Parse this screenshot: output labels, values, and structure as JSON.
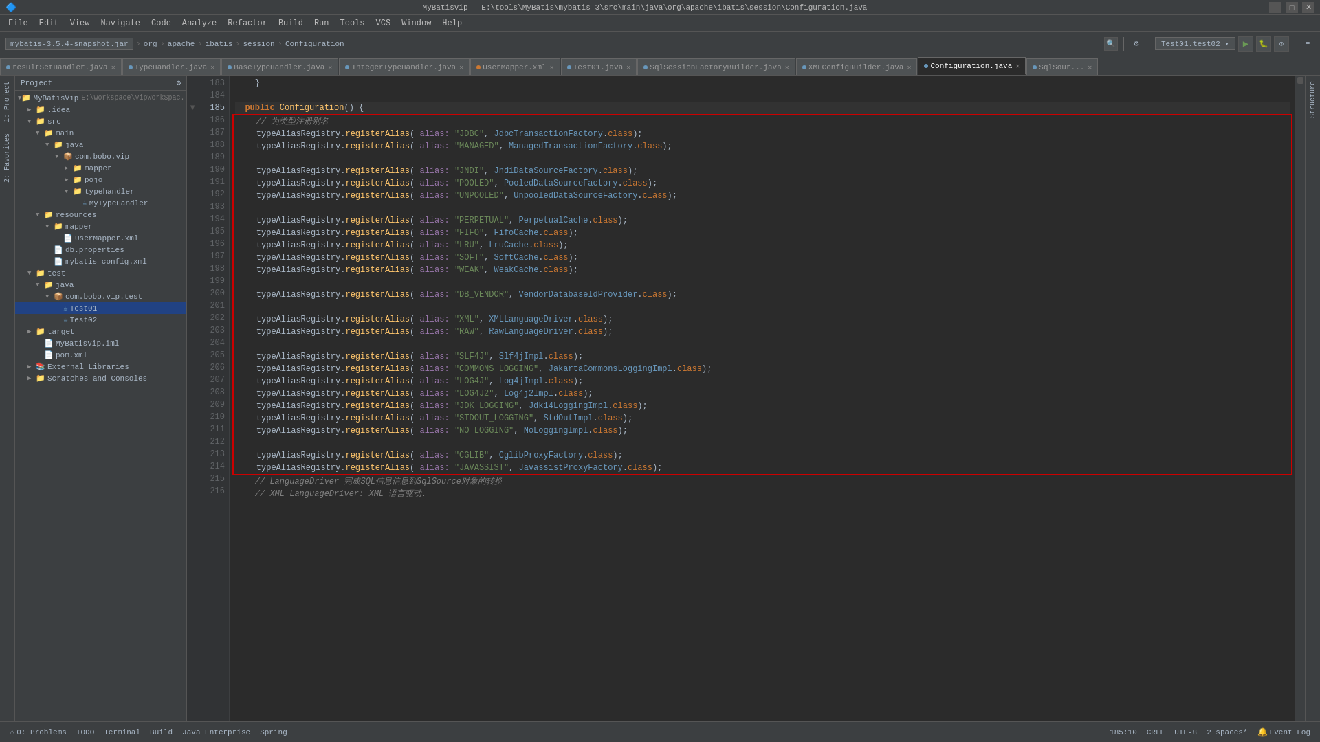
{
  "titlebar": {
    "title": "MyBatisVip – E:\\tools\\MyBatis\\mybatis-3\\src\\main\\java\\org\\apache\\ibatis\\session\\Configuration.java",
    "min": "−",
    "max": "□",
    "close": "✕"
  },
  "menubar": {
    "items": [
      "File",
      "Edit",
      "View",
      "Navigate",
      "Code",
      "Analyze",
      "Refactor",
      "Build",
      "Run",
      "Tools",
      "VCS",
      "Window",
      "Help"
    ]
  },
  "toolbar": {
    "project": "mybatis-3.5.4-snapshot.jar",
    "breadcrumb1": "org",
    "breadcrumb2": "apache",
    "breadcrumb3": "ibatis",
    "breadcrumb4": "session",
    "breadcrumb5": "Configuration",
    "run_config": "Test01.test02",
    "run_label": "▶",
    "debug_label": "🐛",
    "coverage_label": "⊙"
  },
  "filetabs": {
    "tabs": [
      {
        "label": "resultSetHandler.java",
        "active": false
      },
      {
        "label": "TypeHandler.java",
        "active": false
      },
      {
        "label": "BaseTypeHandler.java",
        "active": false
      },
      {
        "label": "IntegerTypeHandler.java",
        "active": false
      },
      {
        "label": "UserMapper.xml",
        "active": false
      },
      {
        "label": "Test01.java",
        "active": false
      },
      {
        "label": "SqlSessionFactoryBuilder.java",
        "active": false
      },
      {
        "label": "XMLConfigBuilder.java",
        "active": false
      },
      {
        "label": "Configuration.java",
        "active": true
      },
      {
        "label": "SqlSour...",
        "active": false
      }
    ]
  },
  "sidebar": {
    "header": "Project",
    "items": [
      {
        "indent": 0,
        "label": "MyBatisVip",
        "type": "project",
        "path": "E:\\workspace\\VipWorkSpac..."
      },
      {
        "indent": 1,
        "label": ".idea",
        "type": "folder"
      },
      {
        "indent": 1,
        "label": "src",
        "type": "folder",
        "open": true
      },
      {
        "indent": 2,
        "label": "main",
        "type": "folder",
        "open": true
      },
      {
        "indent": 3,
        "label": "java",
        "type": "folder",
        "open": true
      },
      {
        "indent": 4,
        "label": "com.bobo.vip",
        "type": "package",
        "open": true
      },
      {
        "indent": 5,
        "label": "mapper",
        "type": "folder"
      },
      {
        "indent": 5,
        "label": "pojo",
        "type": "folder"
      },
      {
        "indent": 5,
        "label": "typehandler",
        "type": "folder",
        "open": true
      },
      {
        "indent": 6,
        "label": "MyTypeHandler",
        "type": "java"
      },
      {
        "indent": 3,
        "label": "resources",
        "type": "folder",
        "open": true
      },
      {
        "indent": 4,
        "label": "mapper",
        "type": "folder",
        "open": true
      },
      {
        "indent": 5,
        "label": "UserMapper.xml",
        "type": "xml"
      },
      {
        "indent": 4,
        "label": "db.properties",
        "type": "file"
      },
      {
        "indent": 4,
        "label": "mybatis-config.xml",
        "type": "xml"
      },
      {
        "indent": 2,
        "label": "test",
        "type": "folder",
        "open": true
      },
      {
        "indent": 3,
        "label": "java",
        "type": "folder",
        "open": true
      },
      {
        "indent": 4,
        "label": "com.bobo.vip.test",
        "type": "package",
        "open": true
      },
      {
        "indent": 5,
        "label": "Test01",
        "type": "java",
        "selected": true
      },
      {
        "indent": 5,
        "label": "Test02",
        "type": "java"
      },
      {
        "indent": 1,
        "label": "target",
        "type": "folder"
      },
      {
        "indent": 2,
        "label": "MyBatisVip.iml",
        "type": "file"
      },
      {
        "indent": 2,
        "label": "pom.xml",
        "type": "xml"
      },
      {
        "indent": 1,
        "label": "External Libraries",
        "type": "folder"
      },
      {
        "indent": 1,
        "label": "Scratches and Consoles",
        "type": "folder"
      }
    ]
  },
  "code": {
    "lines": [
      {
        "n": 183,
        "text": "    }",
        "highlight": false
      },
      {
        "n": 184,
        "text": "",
        "highlight": false
      },
      {
        "n": 185,
        "text": "  public Configuration() {",
        "highlight": false,
        "cursor": true
      },
      {
        "n": 186,
        "text": "    // 为类型注册别名",
        "highlight": true,
        "comment": true
      },
      {
        "n": 187,
        "text": "    typeAliasRegistry.registerAlias( alias: \"JDBC\", JdbcTransactionFactory.class);",
        "highlight": true
      },
      {
        "n": 188,
        "text": "    typeAliasRegistry.registerAlias( alias: \"MANAGED\", ManagedTransactionFactory.class);",
        "highlight": true
      },
      {
        "n": 189,
        "text": "",
        "highlight": true
      },
      {
        "n": 190,
        "text": "    typeAliasRegistry.registerAlias( alias: \"JNDI\", JndiDataSourceFactory.class);",
        "highlight": true
      },
      {
        "n": 191,
        "text": "    typeAliasRegistry.registerAlias( alias: \"POOLED\", PooledDataSourceFactory.class);",
        "highlight": true
      },
      {
        "n": 192,
        "text": "    typeAliasRegistry.registerAlias( alias: \"UNPOOLED\", UnpooledDataSourceFactory.class);",
        "highlight": true
      },
      {
        "n": 193,
        "text": "",
        "highlight": true
      },
      {
        "n": 194,
        "text": "    typeAliasRegistry.registerAlias( alias: \"PERPETUAL\", PerpetualCache.class);",
        "highlight": true
      },
      {
        "n": 195,
        "text": "    typeAliasRegistry.registerAlias( alias: \"FIFO\", FifoCache.class);",
        "highlight": true
      },
      {
        "n": 196,
        "text": "    typeAliasRegistry.registerAlias( alias: \"LRU\", LruCache.class);",
        "highlight": true
      },
      {
        "n": 197,
        "text": "    typeAliasRegistry.registerAlias( alias: \"SOFT\", SoftCache.class);",
        "highlight": true
      },
      {
        "n": 198,
        "text": "    typeAliasRegistry.registerAlias( alias: \"WEAK\", WeakCache.class);",
        "highlight": true
      },
      {
        "n": 199,
        "text": "",
        "highlight": true
      },
      {
        "n": 200,
        "text": "    typeAliasRegistry.registerAlias( alias: \"DB_VENDOR\", VendorDatabaseIdProvider.class);",
        "highlight": true
      },
      {
        "n": 201,
        "text": "",
        "highlight": true
      },
      {
        "n": 202,
        "text": "    typeAliasRegistry.registerAlias( alias: \"XML\", XMLLanguageDriver.class);",
        "highlight": true
      },
      {
        "n": 203,
        "text": "    typeAliasRegistry.registerAlias( alias: \"RAW\", RawLanguageDriver.class);",
        "highlight": true
      },
      {
        "n": 204,
        "text": "",
        "highlight": true
      },
      {
        "n": 205,
        "text": "    typeAliasRegistry.registerAlias( alias: \"SLF4J\", Slf4jImpl.class);",
        "highlight": true
      },
      {
        "n": 206,
        "text": "    typeAliasRegistry.registerAlias( alias: \"COMMONS_LOGGING\", JakartaCommonsLoggingImpl.class);",
        "highlight": true
      },
      {
        "n": 207,
        "text": "    typeAliasRegistry.registerAlias( alias: \"LOG4J\", Log4jImpl.class);",
        "highlight": true
      },
      {
        "n": 208,
        "text": "    typeAliasRegistry.registerAlias( alias: \"LOG4J2\", Log4j2Impl.class);",
        "highlight": true
      },
      {
        "n": 209,
        "text": "    typeAliasRegistry.registerAlias( alias: \"JDK_LOGGING\", Jdk14LoggingImpl.class);",
        "highlight": true
      },
      {
        "n": 210,
        "text": "    typeAliasRegistry.registerAlias( alias: \"STDOUT_LOGGING\", StdOutImpl.class);",
        "highlight": true
      },
      {
        "n": 211,
        "text": "    typeAliasRegistry.registerAlias( alias: \"NO_LOGGING\", NoLoggingImpl.class);",
        "highlight": true
      },
      {
        "n": 212,
        "text": "",
        "highlight": true
      },
      {
        "n": 213,
        "text": "    typeAliasRegistry.registerAlias( alias: \"CGLIB\", CglibProxyFactory.class);",
        "highlight": true
      },
      {
        "n": 214,
        "text": "    typeAliasRegistry.registerAlias( alias: \"JAVASSIST\", JavassistProxyFactory.class);",
        "highlight": true
      },
      {
        "n": 215,
        "text": "    // LanguageDriver 完成SQL信息信息到SqlSource对象的转换",
        "highlight": false,
        "comment": true
      },
      {
        "n": 216,
        "text": "    // XML LanguageDriver: XML 语言驱动.",
        "highlight": false,
        "comment": true
      }
    ]
  },
  "statusbar": {
    "problems_label": "0: Problems",
    "todo_label": "TODO",
    "terminal_label": "Terminal",
    "build_label": "Build",
    "java_enterprise_label": "Java Enterprise",
    "spring_label": "Spring",
    "position": "185:10",
    "line_separator": "CRLF",
    "encoding": "UTF-8",
    "indent": "2 spaces*",
    "event_log": "Event Log"
  },
  "left_tabs": [
    "1: Project",
    "2: Favorites"
  ],
  "colors": {
    "bg": "#2b2b2b",
    "sidebar_bg": "#3c3f41",
    "accent": "#214283",
    "highlight_border": "#ff0000",
    "keyword": "#cc7832",
    "string": "#6a8759",
    "method": "#ffc66d",
    "class": "#6897bb",
    "comment": "#808080",
    "alias_param": "#9876aa"
  }
}
